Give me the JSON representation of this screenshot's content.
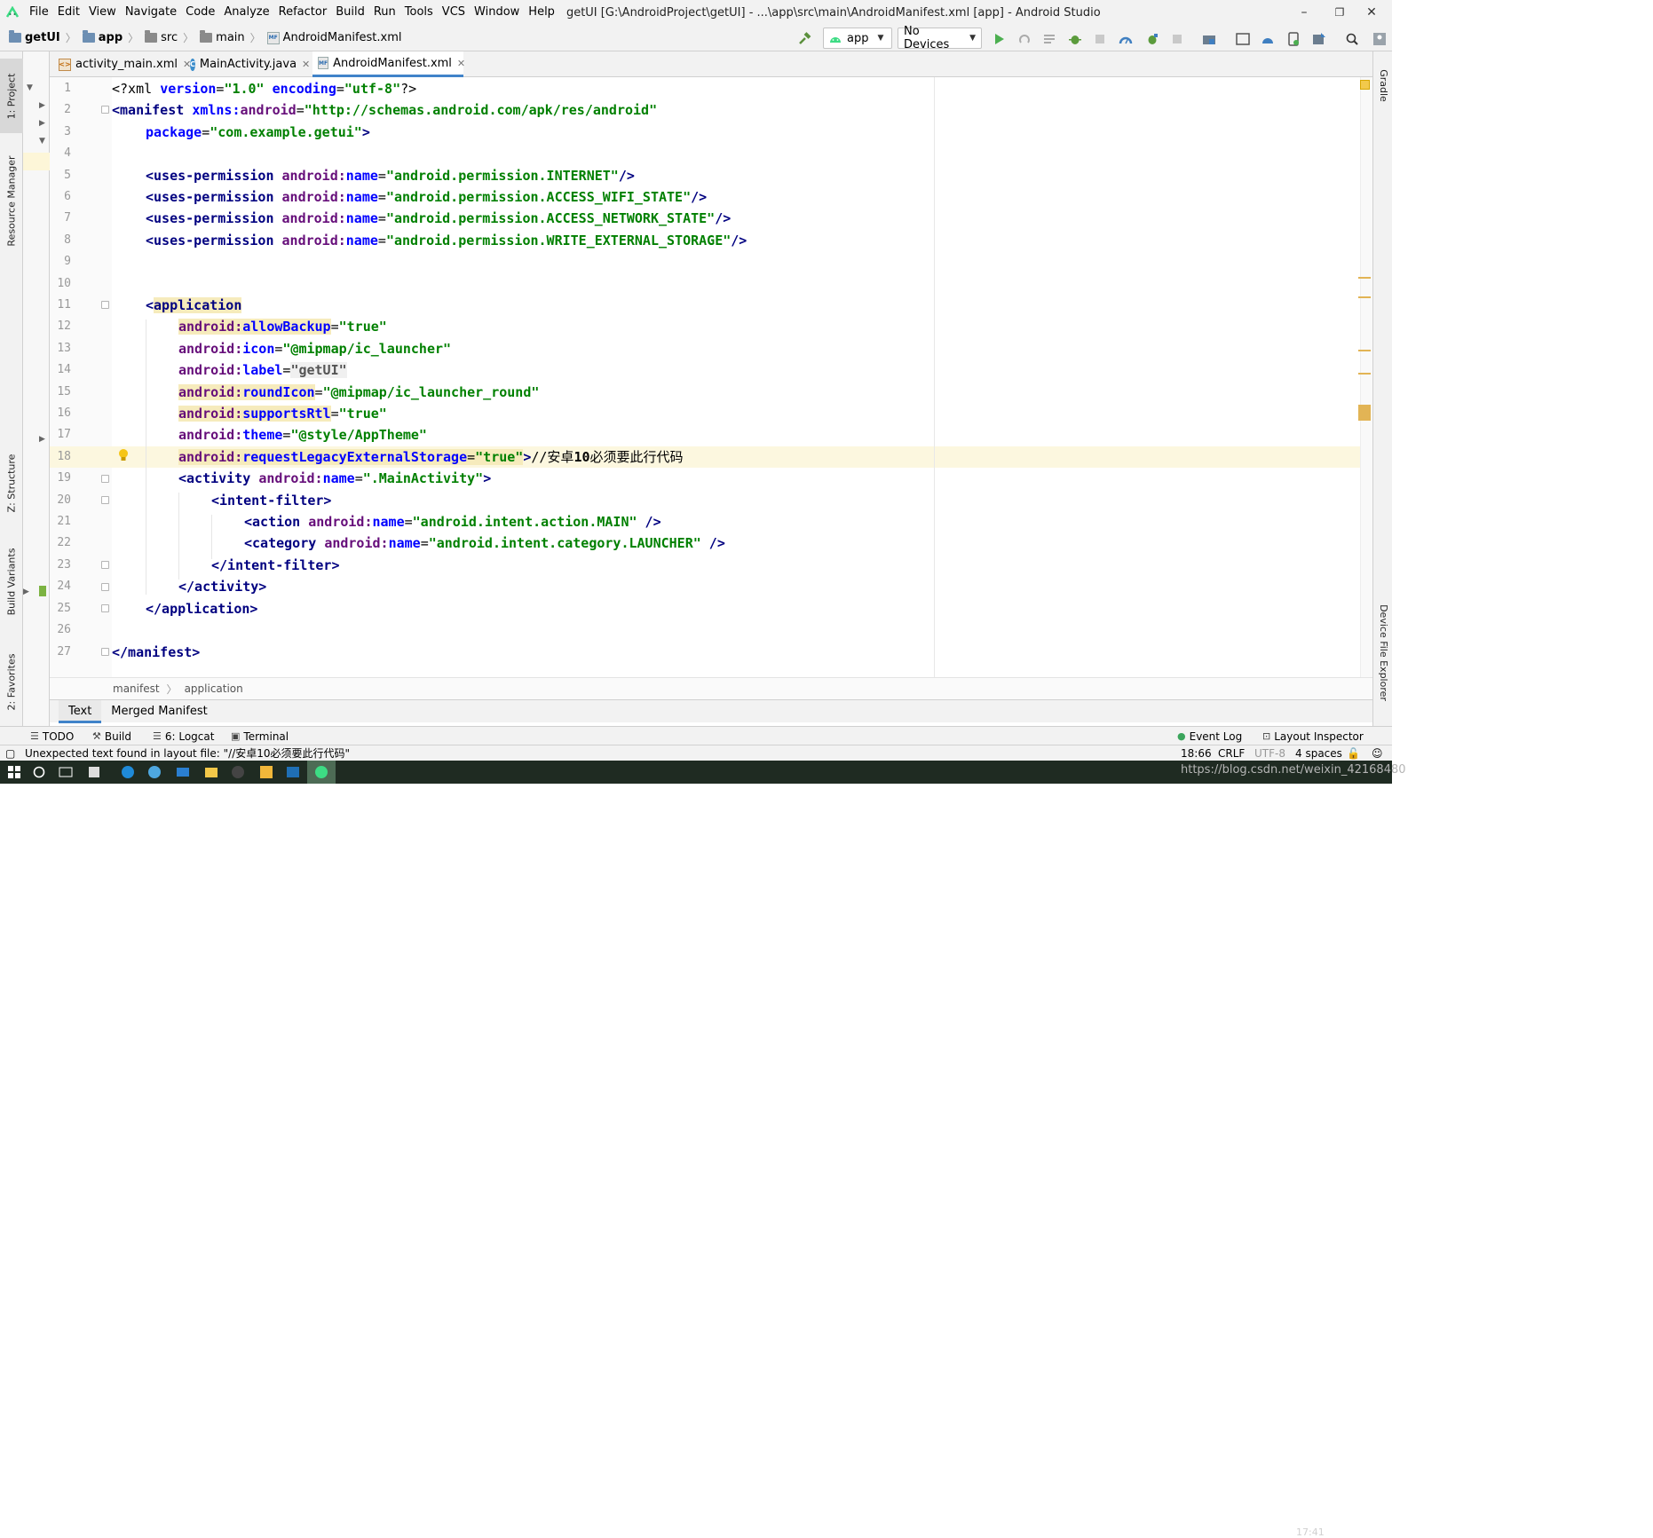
{
  "menubar": {
    "items": [
      "File",
      "Edit",
      "View",
      "Navigate",
      "Code",
      "Analyze",
      "Refactor",
      "Build",
      "Run",
      "Tools",
      "VCS",
      "Window",
      "Help"
    ],
    "window_title": "getUI [G:\\AndroidProject\\getUI] - ...\\app\\src\\main\\AndroidManifest.xml [app] - Android Studio",
    "minimize": "–",
    "restore": "❐",
    "close": "✕"
  },
  "navbar": {
    "crumbs": [
      "getUI",
      "app",
      "src",
      "main",
      "AndroidManifest.xml"
    ],
    "run_config": "app",
    "device": "No Devices"
  },
  "left_tools": [
    "1: Project",
    "Resource Manager",
    "Z: Structure",
    "Build Variants",
    "2: Favorites"
  ],
  "right_tools": [
    "Gradle",
    "Device File Explorer"
  ],
  "tabs": [
    {
      "label": "activity_main.xml",
      "icon": "xml-file-icon"
    },
    {
      "label": "MainActivity.java",
      "icon": "java-class-icon"
    },
    {
      "label": "AndroidManifest.xml",
      "icon": "manifest-file-icon",
      "active": true
    }
  ],
  "code": {
    "line_numbers": [
      "1",
      "2",
      "3",
      "4",
      "5",
      "6",
      "7",
      "8",
      "9",
      "10",
      "11",
      "12",
      "13",
      "14",
      "15",
      "16",
      "17",
      "18",
      "19",
      "20",
      "21",
      "22",
      "23",
      "24",
      "25",
      "26",
      "27"
    ],
    "l1_a": "<?xml ",
    "l1_b": "version",
    "l1_c": "=",
    "l1_d": "\"1.0\"",
    "l1_e": " ",
    "l1_f": "encoding",
    "l1_g": "=",
    "l1_h": "\"utf-8\"",
    "l1_i": "?>",
    "l2_a": "<manifest ",
    "l2_b": "xmlns:",
    "l2_c": "android",
    "l2_d": "=",
    "l2_e": "\"http://schemas.android.com/apk/res/android\"",
    "l3_a": "package",
    "l3_b": "=",
    "l3_c": "\"com.example.getui\"",
    "l3_d": ">",
    "perm_tag": "<uses-permission ",
    "ns": "android:",
    "name_attr": "name",
    "eq": "=",
    "l5_val": "\"android.permission.INTERNET\"",
    "l6_val": "\"android.permission.ACCESS_WIFI_STATE\"",
    "l7_val": "\"android.permission.ACCESS_NETWORK_STATE\"",
    "l8_val": "\"android.permission.WRITE_EXTERNAL_STORAGE\"",
    "self_close": "/>",
    "l11_a": "<",
    "l11_b": "application",
    "l12_attr": "allowBackup",
    "l12_val": "\"true\"",
    "l13_attr": "icon",
    "l13_val": "\"@mipmap/ic_launcher\"",
    "l14_attr": "label",
    "l14_val": "\"getUI\"",
    "l15_attr": "roundIcon",
    "l15_val": "\"@mipmap/ic_launcher_round\"",
    "l16_attr": "supportsRtl",
    "l16_val": "\"true\"",
    "l17_attr": "theme",
    "l17_val": "\"@style/AppTheme\"",
    "l18_attr": "requestLegacyExternalStorage",
    "l18_val": "\"true\"",
    "l18_end": ">",
    "l18_comment_a": "//安卓",
    "l18_comment_b": "10",
    "l18_comment_c": "必须要此行代码",
    "l19_tag": "<activity ",
    "l19_val": "\".MainActivity\"",
    "gt": ">",
    "l20_tag": "<intent-filter>",
    "l21_tag": "<action ",
    "l21_val": "\"android.intent.action.MAIN\"",
    "l21_end": " />",
    "l22_tag": "<category ",
    "l22_val": "\"android.intent.category.LAUNCHER\"",
    "l22_end": " />",
    "l23_tag": "</intent-filter>",
    "l24_tag": "</activity>",
    "l25_tag": "</application>",
    "l27_tag": "</manifest>"
  },
  "xml_breadcrumb": [
    "manifest",
    "application"
  ],
  "editor_subtabs": [
    "Text",
    "Merged Manifest"
  ],
  "bottom_tools": {
    "todo": "TODO",
    "build": "Build",
    "logcat": "6: Logcat",
    "terminal": "Terminal",
    "event_log": "Event Log",
    "layout_inspector": "Layout Inspector"
  },
  "status": {
    "message": "Unexpected text found in layout file: \"//安卓10必须要此行代码\"",
    "position": "18:66",
    "line_sep": "CRLF",
    "encoding": "UTF-8",
    "indent": "4 spaces"
  },
  "taskbar": {
    "clock": "17:41",
    "watermark": "https://blog.csdn.net/weixin_42168480"
  }
}
